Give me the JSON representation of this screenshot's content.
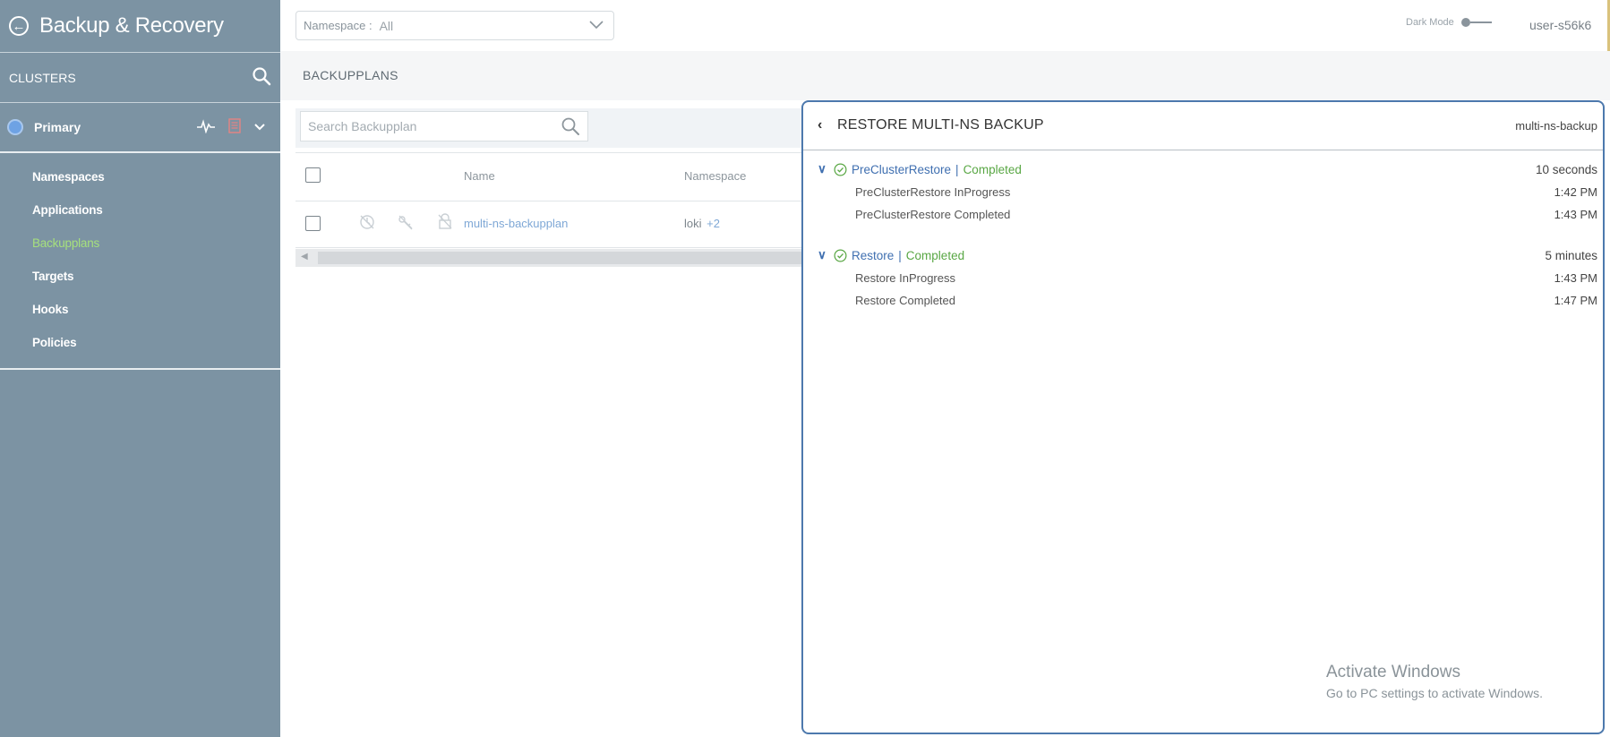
{
  "app": {
    "title": "Backup & Recovery"
  },
  "sidebar": {
    "clusters_label": "CLUSTERS",
    "cluster": {
      "name": "Primary"
    },
    "items": [
      {
        "label": "Namespaces"
      },
      {
        "label": "Applications"
      },
      {
        "label": "Backupplans",
        "active": true
      },
      {
        "label": "Targets"
      },
      {
        "label": "Hooks"
      },
      {
        "label": "Policies"
      }
    ]
  },
  "topbar": {
    "namespace_label": "Namespace :",
    "namespace_value": "All",
    "dark_mode_label": "Dark Mode",
    "dark_mode_on": false,
    "user": "user-s56k6"
  },
  "page": {
    "title": "BACKUPPLANS"
  },
  "search": {
    "placeholder": "Search Backupplan"
  },
  "table": {
    "columns": [
      "Name",
      "Namespace"
    ],
    "rows": [
      {
        "name": "multi-ns-backupplan",
        "namespace": "loki",
        "more": "+2"
      }
    ]
  },
  "panel": {
    "title": "RESTORE MULTI-NS BACKUP",
    "reference": "multi-ns-backup",
    "steps": [
      {
        "name": "PreClusterRestore",
        "separator": "|",
        "status": "Completed",
        "duration": "10 seconds",
        "events": [
          {
            "label": "PreClusterRestore InProgress",
            "time": "1:42 PM"
          },
          {
            "label": "PreClusterRestore Completed",
            "time": "1:43 PM"
          }
        ]
      },
      {
        "name": "Restore",
        "separator": "|",
        "status": "Completed",
        "duration": "5 minutes",
        "events": [
          {
            "label": "Restore InProgress",
            "time": "1:43 PM"
          },
          {
            "label": "Restore Completed",
            "time": "1:47 PM"
          }
        ]
      }
    ]
  },
  "watermark": {
    "line1": "Activate Windows",
    "line2": "Go to PC settings to activate Windows."
  },
  "colors": {
    "sidebar_bg": "#7c93a3",
    "active_nav": "#a6e07d",
    "link": "#7fa8d6",
    "panel_border": "#4d79ad",
    "status_ok": "#59a744"
  }
}
